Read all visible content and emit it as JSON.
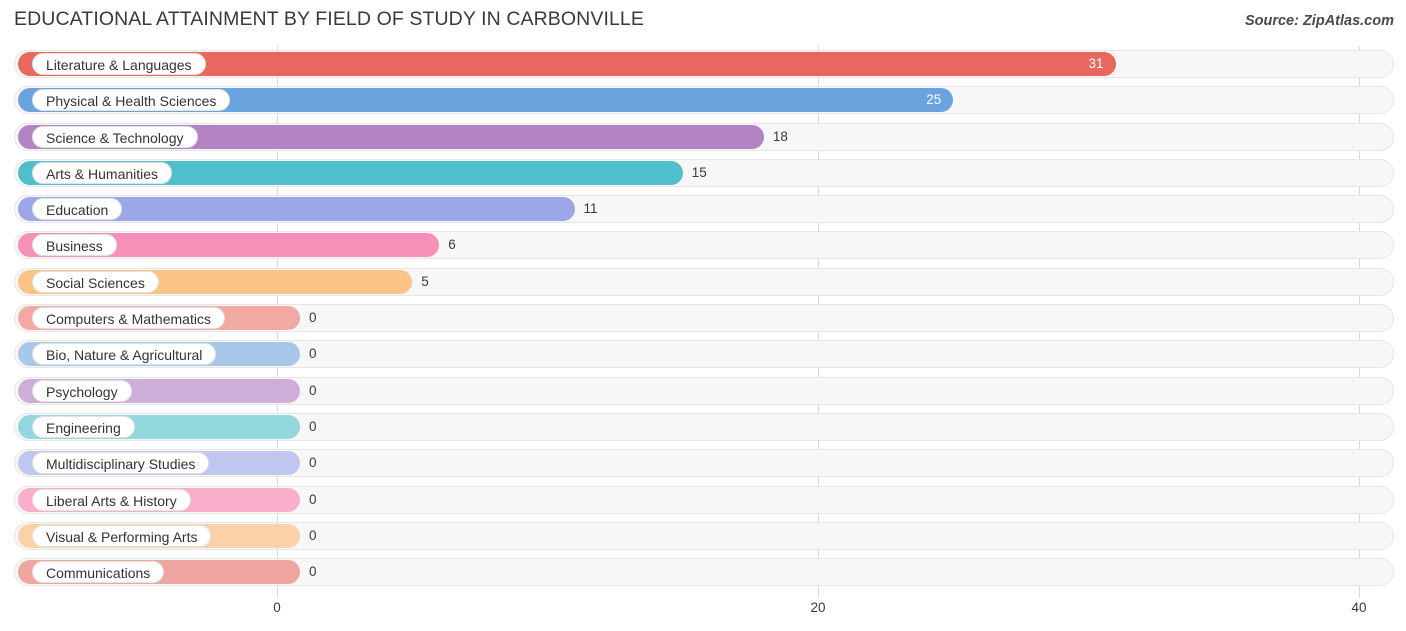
{
  "header": {
    "title": "EDUCATIONAL ATTAINMENT BY FIELD OF STUDY IN CARBONVILLE",
    "source": "Source: ZipAtlas.com"
  },
  "chart_data": {
    "type": "bar",
    "orientation": "horizontal",
    "title": "EDUCATIONAL ATTAINMENT BY FIELD OF STUDY IN CARBONVILLE",
    "subtitle": "",
    "xlabel": "",
    "ylabel": "",
    "xlim": [
      0,
      40
    ],
    "xticks": [
      "0",
      "20",
      "40"
    ],
    "xtick_values": [
      0,
      20,
      40
    ],
    "grid": true,
    "legend": false,
    "categories": [
      "Literature & Languages",
      "Physical & Health Sciences",
      "Science & Technology",
      "Arts & Humanities",
      "Education",
      "Business",
      "Social Sciences",
      "Computers & Mathematics",
      "Bio, Nature & Agricultural",
      "Psychology",
      "Engineering",
      "Multidisciplinary Studies",
      "Liberal Arts & History",
      "Visual & Performing Arts",
      "Communications"
    ],
    "values": [
      31,
      25,
      18,
      15,
      11,
      6,
      5,
      0,
      0,
      0,
      0,
      0,
      0,
      0,
      0
    ],
    "value_labels": [
      "31",
      "25",
      "18",
      "15",
      "11",
      "6",
      "5",
      "0",
      "0",
      "0",
      "0",
      "0",
      "0",
      "0",
      "0"
    ],
    "colors": [
      "#e8675e",
      "#6aa4de",
      "#b383c4",
      "#4fbfcb",
      "#9ba7e8",
      "#f790b8",
      "#fbc386",
      "#f2a9a3",
      "#a8c8ea",
      "#cdaed8",
      "#93d8dc",
      "#c0c6ef",
      "#f9afcb",
      "#fbd2a7",
      "#f0a6a0"
    ]
  },
  "rows": [
    {
      "label": "Literature & Languages",
      "value": 31,
      "display": "31",
      "color": "#e8675e",
      "inside": true
    },
    {
      "label": "Physical & Health Sciences",
      "value": 25,
      "display": "25",
      "color": "#6aa4de",
      "inside": true
    },
    {
      "label": "Science & Technology",
      "value": 18,
      "display": "18",
      "color": "#b383c4",
      "inside": false
    },
    {
      "label": "Arts & Humanities",
      "value": 15,
      "display": "15",
      "color": "#4fbfcb",
      "inside": false
    },
    {
      "label": "Education",
      "value": 11,
      "display": "11",
      "color": "#9ba7e8",
      "inside": false
    },
    {
      "label": "Business",
      "value": 6,
      "display": "6",
      "color": "#f790b8",
      "inside": false
    },
    {
      "label": "Social Sciences",
      "value": 5,
      "display": "5",
      "color": "#fbc386",
      "inside": false
    },
    {
      "label": "Computers & Mathematics",
      "value": 0,
      "display": "0",
      "color": "#f2a9a3",
      "inside": false
    },
    {
      "label": "Bio, Nature & Agricultural",
      "value": 0,
      "display": "0",
      "color": "#a8c8ea",
      "inside": false
    },
    {
      "label": "Psychology",
      "value": 0,
      "display": "0",
      "color": "#cdaed8",
      "inside": false
    },
    {
      "label": "Engineering",
      "value": 0,
      "display": "0",
      "color": "#93d8dc",
      "inside": false
    },
    {
      "label": "Multidisciplinary Studies",
      "value": 0,
      "display": "0",
      "color": "#c0c6ef",
      "inside": false
    },
    {
      "label": "Liberal Arts & History",
      "value": 0,
      "display": "0",
      "color": "#f9afcb",
      "inside": false
    },
    {
      "label": "Visual & Performing Arts",
      "value": 0,
      "display": "0",
      "color": "#fbd2a7",
      "inside": false
    },
    {
      "label": "Communications",
      "value": 0,
      "display": "0",
      "color": "#f0a6a0",
      "inside": false
    }
  ],
  "axis": {
    "ticks": [
      {
        "label": "0",
        "value": 0
      },
      {
        "label": "20",
        "value": 20
      },
      {
        "label": "40",
        "value": 40
      }
    ]
  }
}
